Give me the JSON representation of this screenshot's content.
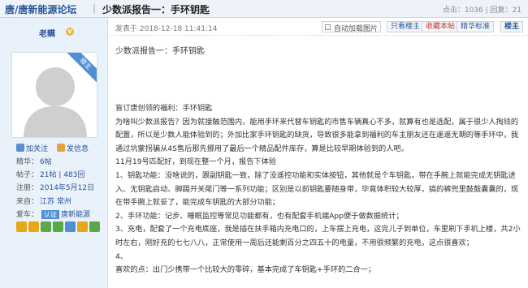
{
  "header": {
    "forum_name": "唐/唐新能源论坛",
    "separator": "|",
    "thread_title": "少数派报告一：手环钥匙",
    "views_label": "点击：",
    "views": "1036",
    "replies_label": "回复：",
    "replies": "21"
  },
  "author": {
    "name": "老瞒",
    "verified_mark": "V",
    "ribbon": "楼主",
    "follow_label": "加关注",
    "message_label": "发信息",
    "level_label": "精华：",
    "level_value": "6帖",
    "posts_label": "帖子：",
    "posts_value": "21帖 | 483回",
    "reg_label": "注册：",
    "reg_value": "2014年5月12日",
    "region_label": "来自：",
    "region_value": "江苏 常州",
    "car_label": "爱车：",
    "car_badge": "认证",
    "car_value": "唐新能源",
    "medal_colors": [
      "#e6a817",
      "#e6a817",
      "#5ba84a",
      "#5ba84a",
      "#4f8fd6",
      "#e6a817",
      "#5ba84a"
    ]
  },
  "post_toolbar": {
    "time": "发表于 2018-12-18 11:41:14",
    "autoload_label": "自动加载图片",
    "only_author_label": "只看楼主",
    "bookmark_label": "收藏本帖",
    "featured_label": "精华标准",
    "floor_label": "楼主"
  },
  "post": {
    "subject": "少数派报告一：手环钥匙",
    "lines": [
      "盲订唐创领的福利：手环钥匙",
      "为啥叫少数派报告？因为就接触范围内，能用手环来代替车钥匙的市售车辆真心不多，就算有也是选配，属于很少人掏钱的配置，所以是少数人能体验到的；外加比家手环钥匙的缺货，导致很多能拿到福利的车主朋友还在遥遥无期的等手环中，我通过坑蒙拐骗从4S售后那先挪用了最后一个精品配件库存，算是比较早期体验到的人吧。",
      "11月19号匹配好，到现在整一个月，报告下体验",
      "1、钥匙功能：没啥说的，跟副钥匙一致，除了没遥控功能和实体按钮，其他就是个车钥匙，带在手腕上就能完成无钥匙进入、无钥匙启动、脚踢开关尾门等一系列功能；区别是以前钥匙要随身带，毕竟体积较大较厚，搞的裤兜里鼓鼓囊囊的，现在带手腕上就妥了，能完成车钥匙的大部分功能；",
      "2、手环功能：记步、睡眠监控等常见功能都有，也有配套手机端App便于做数据统计；",
      "3、充电，配套了一个充电底座，我是插在扶手箱内充电口的，上车摆上充电，这完儿子到单位，车里刷下手机上楼，共2小时左右，刚好充的七七八八，正常使用一周后还能剩百分之四五十的电量，不用很频繁的充电，这点很喜欢；",
      "4、",
      "喜欢的点：出门少携带一个比较大的零碎，基本完成了车钥匙+手环的二合一；"
    ]
  }
}
